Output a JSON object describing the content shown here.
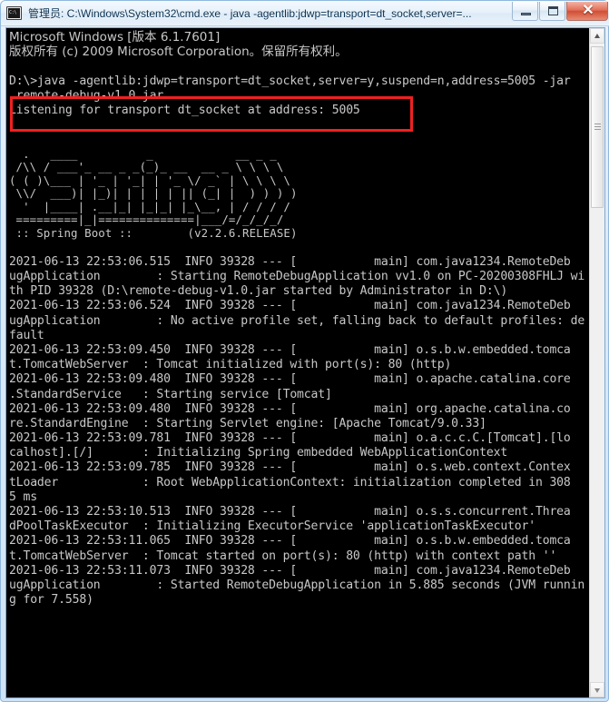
{
  "window": {
    "title": "管理员: C:\\Windows\\System32\\cmd.exe - java  -agentlib:jdwp=transport=dt_socket,server=...",
    "icon_name": "cmd-console-icon",
    "buttons": {
      "minimize_label": "Minimize",
      "maximize_label": "Maximize",
      "close_label": "✕"
    }
  },
  "highlight": {
    "color": "#f02020",
    "target_text": "Listening for transport dt_socket at address: 5005"
  },
  "console": {
    "background": "#000000",
    "foreground": "#c8c8c8",
    "lines": [
      {
        "text": "Microsoft Windows [版本 6.1.7601]",
        "cjk": true
      },
      {
        "text": "版权所有 (c) 2009 Microsoft Corporation。保留所有权利。",
        "cjk": true
      },
      {
        "text": "",
        "blank": true
      },
      {
        "text": "D:\\>java -agentlib:jdwp=transport=dt_socket,server=y,suspend=n,address=5005 -jar"
      },
      {
        "text": " remote-debug-v1.0.jar"
      },
      {
        "text": "Listening for transport dt_socket at address: 5005"
      },
      {
        "text": "",
        "blank": true
      },
      {
        "text": "",
        "blank": true
      },
      {
        "text": "  .   ____          _            __ _ _",
        "banner": true
      },
      {
        "text": " /\\\\ / ___'_ __ _ _(_)_ __  __ _ \\ \\ \\ \\",
        "banner": true
      },
      {
        "text": "( ( )\\___ | '_ | '_| | '_ \\/ _` | \\ \\ \\ \\",
        "banner": true
      },
      {
        "text": " \\\\/  ___)| |_)| | | | | || (_| |  ) ) ) )",
        "banner": true
      },
      {
        "text": "  '  |____| .__|_| |_|_| |_\\__, | / / / /",
        "banner": true
      },
      {
        "text": " =========|_|==============|___/=/_/_/_/",
        "banner": true
      },
      {
        "text": " :: Spring Boot ::        (v2.2.6.RELEASE)",
        "banner": true
      },
      {
        "text": "",
        "blank": true
      },
      {
        "text": "2021-06-13 22:53:06.515  INFO 39328 --- [           main] com.java1234.RemoteDeb"
      },
      {
        "text": "ugApplication        : Starting RemoteDebugApplication vv1.0 on PC-20200308FHLJ wi"
      },
      {
        "text": "th PID 39328 (D:\\remote-debug-v1.0.jar started by Administrator in D:\\)"
      },
      {
        "text": "2021-06-13 22:53:06.524  INFO 39328 --- [           main] com.java1234.RemoteDeb"
      },
      {
        "text": "ugApplication        : No active profile set, falling back to default profiles: de"
      },
      {
        "text": "fault"
      },
      {
        "text": "2021-06-13 22:53:09.450  INFO 39328 --- [           main] o.s.b.w.embedded.tomca"
      },
      {
        "text": "t.TomcatWebServer  : Tomcat initialized with port(s): 80 (http)"
      },
      {
        "text": "2021-06-13 22:53:09.480  INFO 39328 --- [           main] o.apache.catalina.core"
      },
      {
        "text": ".StandardService   : Starting service [Tomcat]"
      },
      {
        "text": "2021-06-13 22:53:09.480  INFO 39328 --- [           main] org.apache.catalina.co"
      },
      {
        "text": "re.StandardEngine  : Starting Servlet engine: [Apache Tomcat/9.0.33]"
      },
      {
        "text": "2021-06-13 22:53:09.781  INFO 39328 --- [           main] o.a.c.c.C.[Tomcat].[lo"
      },
      {
        "text": "calhost].[/]       : Initializing Spring embedded WebApplicationContext"
      },
      {
        "text": "2021-06-13 22:53:09.785  INFO 39328 --- [           main] o.s.web.context.Contex"
      },
      {
        "text": "tLoader            : Root WebApplicationContext: initialization completed in 308"
      },
      {
        "text": "5 ms"
      },
      {
        "text": "2021-06-13 22:53:10.513  INFO 39328 --- [           main] o.s.s.concurrent.Threa"
      },
      {
        "text": "dPoolTaskExecutor  : Initializing ExecutorService 'applicationTaskExecutor'"
      },
      {
        "text": "2021-06-13 22:53:11.065  INFO 39328 --- [           main] o.s.b.w.embedded.tomca"
      },
      {
        "text": "t.TomcatWebServer  : Tomcat started on port(s): 80 (http) with context path ''"
      },
      {
        "text": "2021-06-13 22:53:11.073  INFO 39328 --- [           main] com.java1234.RemoteDeb"
      },
      {
        "text": "ugApplication        : Started RemoteDebugApplication in 5.885 seconds (JVM runnin"
      },
      {
        "text": "g for 7.558)"
      }
    ]
  },
  "scrollbar": {
    "up_arrow_name": "scroll-up-arrow",
    "down_arrow_name": "scroll-down-arrow",
    "thumb_name": "scroll-thumb"
  }
}
